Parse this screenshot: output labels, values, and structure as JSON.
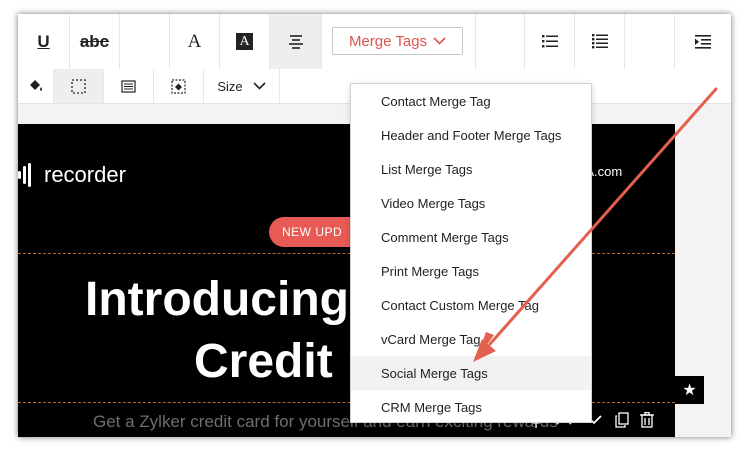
{
  "toolbar": {
    "underline_label": "U",
    "strikethrough_label": "abc",
    "font_label": "A",
    "font_bg_label": "A",
    "merge_tags_label": "Merge Tags",
    "size_label": "Size"
  },
  "merge_menu": {
    "items": [
      {
        "label": "Contact Merge Tag"
      },
      {
        "label": "Header and Footer Merge Tags"
      },
      {
        "label": "List Merge Tags"
      },
      {
        "label": "Video Merge Tags"
      },
      {
        "label": "Comment Merge Tags"
      },
      {
        "label": "Print Merge Tags"
      },
      {
        "label": "Contact Custom Merge Tag"
      },
      {
        "label": "vCard Merge Tag"
      },
      {
        "label": "Social Merge Tags"
      },
      {
        "label": "CRM Merge Tags"
      }
    ],
    "highlighted_index": 8
  },
  "email": {
    "logo_text": "recorder",
    "brand_domain": "KEA.com",
    "badge_text": "NEW UPD",
    "headline_line1": "Introducing",
    "headline_line2": "Credit",
    "subtext": "Get a Zylker credit card for yourself and earn exciting rewards"
  },
  "colors": {
    "accent": "#e0524f",
    "badge": "#e85a54",
    "annotation_arrow": "#e3604f",
    "canvas_bg": "#000000"
  }
}
